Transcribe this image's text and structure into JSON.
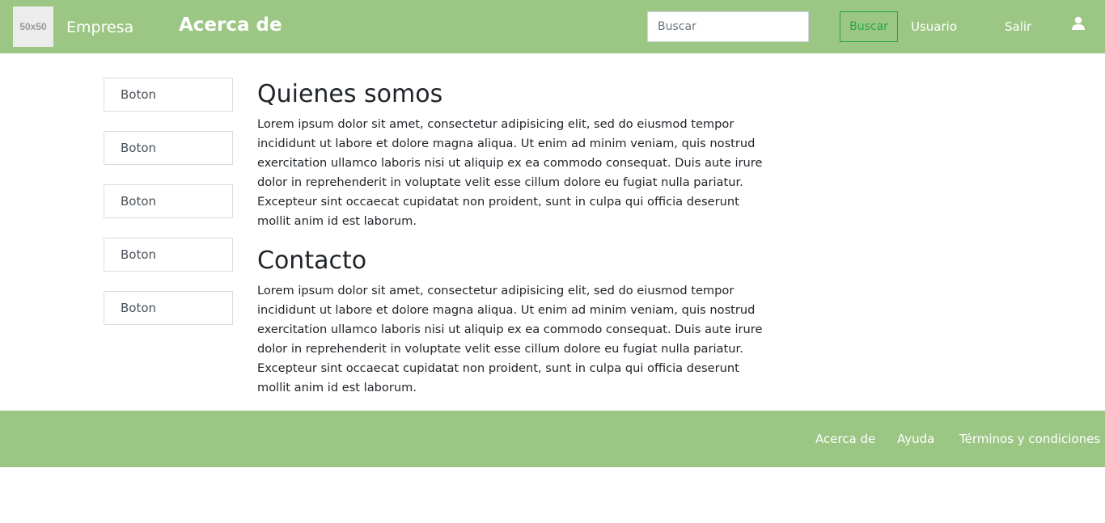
{
  "header": {
    "logo_text": "50x50",
    "brand": "Empresa",
    "page_title": "Acerca de",
    "search": {
      "placeholder": "Buscar",
      "value": ""
    },
    "search_button": "Buscar",
    "user_link": "Usuario",
    "logout_link": "Salir",
    "user_icon": "user-icon"
  },
  "sidebar": {
    "buttons": [
      {
        "label": "Boton"
      },
      {
        "label": "Boton"
      },
      {
        "label": "Boton"
      },
      {
        "label": "Boton"
      },
      {
        "label": "Boton"
      }
    ]
  },
  "main": {
    "sections": [
      {
        "title": "Quienes somos",
        "text": "Lorem ipsum dolor sit amet, consectetur adipisicing elit, sed do eiusmod tempor incididunt ut labore et dolore magna aliqua. Ut enim ad minim veniam, quis nostrud exercitation ullamco laboris nisi ut aliquip ex ea commodo consequat. Duis aute irure dolor in reprehenderit in voluptate velit esse cillum dolore eu fugiat nulla pariatur. Excepteur sint occaecat cupidatat non proident, sunt in culpa qui officia deserunt mollit anim id est laborum."
      },
      {
        "title": "Contacto",
        "text": "Lorem ipsum dolor sit amet, consectetur adipisicing elit, sed do eiusmod tempor incididunt ut labore et dolore magna aliqua. Ut enim ad minim veniam, quis nostrud exercitation ullamco laboris nisi ut aliquip ex ea commodo consequat. Duis aute irure dolor in reprehenderit in voluptate velit esse cillum dolore eu fugiat nulla pariatur. Excepteur sint occaecat cupidatat non proident, sunt in culpa qui officia deserunt mollit anim id est laborum."
      }
    ]
  },
  "footer": {
    "links": [
      {
        "label": "Acerca de"
      },
      {
        "label": "Ayuda"
      },
      {
        "label": "Términos y condiciones"
      }
    ]
  },
  "colors": {
    "bar_green": "#9bc683",
    "search_button_green": "#28a745"
  }
}
